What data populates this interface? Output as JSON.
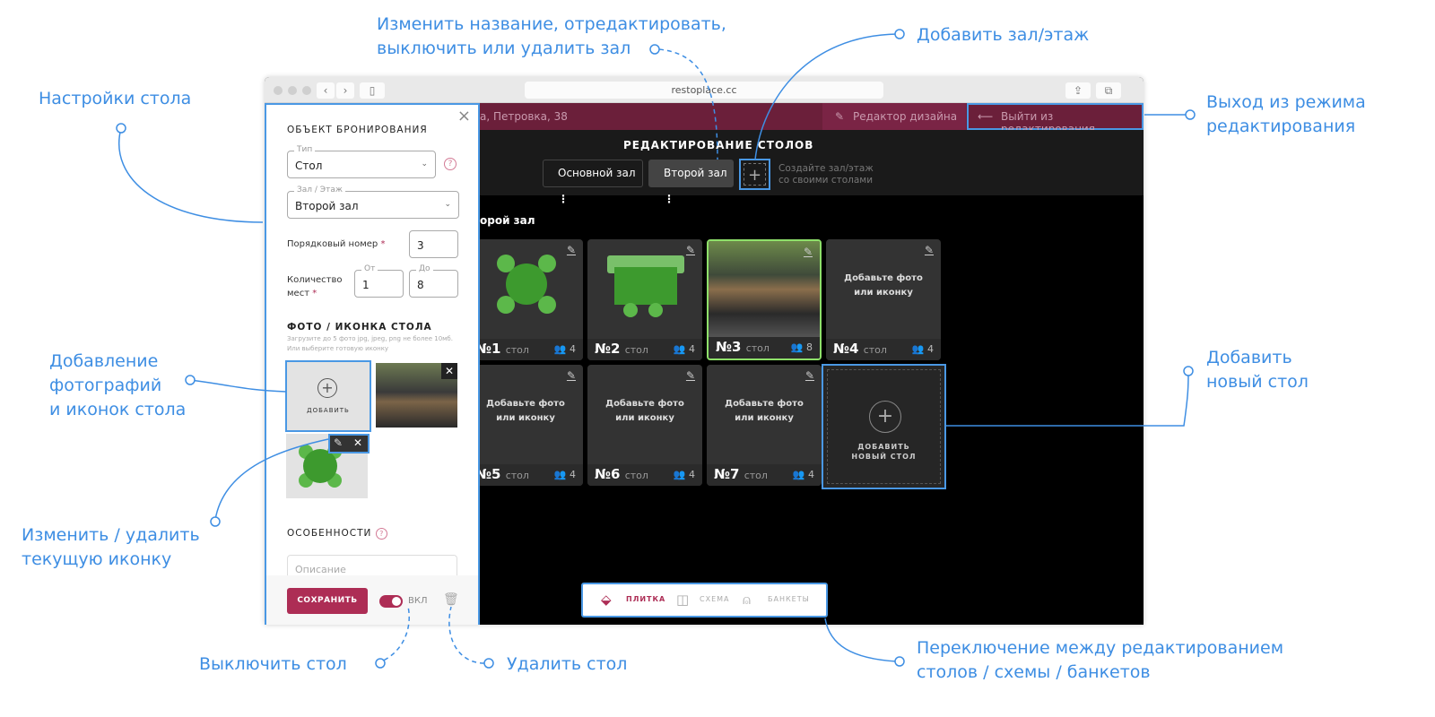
{
  "browser": {
    "url": "restoplace.cc"
  },
  "header": {
    "address": "а, Петровка, 38",
    "design_editor": "Редактор дизайна",
    "exit_edit": "Выйти из редактирования"
  },
  "editor": {
    "title": "РЕДАКТИРОВАНИЕ СТОЛОВ",
    "halls": [
      {
        "label": "Основной зал"
      },
      {
        "label": "Второй зал"
      }
    ],
    "add_hall_plus": "+",
    "add_hall_hint_1": "Создайте зал/этаж",
    "add_hall_hint_2": "со своими столами",
    "current_hall": "орой зал"
  },
  "tables": [
    {
      "num": "№1",
      "word": "стол",
      "seats": "4",
      "image": "round-table-icon"
    },
    {
      "num": "№2",
      "word": "стол",
      "seats": "4",
      "image": "sofa-table-icon"
    },
    {
      "num": "№3",
      "word": "стол",
      "seats": "8",
      "image": "photo",
      "selected": true
    },
    {
      "num": "№4",
      "word": "стол",
      "seats": "4",
      "placeholder": "Добавьте фото или иконку"
    },
    {
      "num": "№5",
      "word": "стол",
      "seats": "4",
      "placeholder": "Добавьте фото или иконку"
    },
    {
      "num": "№6",
      "word": "стол",
      "seats": "4",
      "placeholder": "Добавьте фото или иконку"
    },
    {
      "num": "№7",
      "word": "стол",
      "seats": "4",
      "placeholder": "Добавьте фото или иконку"
    }
  ],
  "add_table": {
    "line1": "ДОБАВИТЬ",
    "line2": "НОВЫЙ СТОЛ"
  },
  "panel": {
    "section_title": "ОБЪЕКТ БРОНИРОВАНИЯ",
    "type_label": "Тип",
    "type_value": "Стол",
    "hall_label": "Зал / Этаж",
    "hall_value": "Второй зал",
    "order_label": "Порядковый номер",
    "order_value": "3",
    "seats_label_1": "Количество",
    "seats_label_2": "мест",
    "from_label": "От",
    "from_value": "1",
    "to_label": "До",
    "to_value": "8",
    "required": "*",
    "photo_title": "ФОТО / ИКОНКА СТОЛА",
    "photo_hint_1": "Загрузите до 5 фото jpg, jpeg, png не более 10мб.",
    "photo_hint_2": "Или выберите готовую иконку",
    "add_label": "ДОБАВИТЬ",
    "features_title": "ОСОБЕННОСТИ",
    "description_placeholder": "Описание",
    "save": "СОХРАНИТЬ",
    "toggle_label": "ВКЛ",
    "toggle_on": true
  },
  "modes": [
    {
      "label": "ПЛИТКА",
      "active": true
    },
    {
      "label": "СХЕМА"
    },
    {
      "label": "БАНКЕТЫ"
    }
  ],
  "annotations": {
    "table_settings": "Настройки стола",
    "rename_1": "Изменить название, отредактировать,",
    "rename_2": "выключить или удалить зал",
    "add_hall": "Добавить зал/этаж",
    "exit_1": "Выход из режима",
    "exit_2": "редактирования",
    "add_photos_1": "Добавление",
    "add_photos_2": "фотографий",
    "add_photos_3": "и иконок стола",
    "add_table_1": "Добавить",
    "add_table_2": "новый стол",
    "edit_icon_1": "Изменить / удалить",
    "edit_icon_2": "текущую иконку",
    "disable_table": "Выключить стол",
    "delete_table": "Удалить стол",
    "switch_1": "Переключение между редактированием",
    "switch_2": "столов / схемы / банкетов"
  },
  "colors": {
    "accent": "#ad2d55",
    "header": "#6b1f3a",
    "annotation": "#3e8ee3",
    "selected": "#8ee06a"
  }
}
